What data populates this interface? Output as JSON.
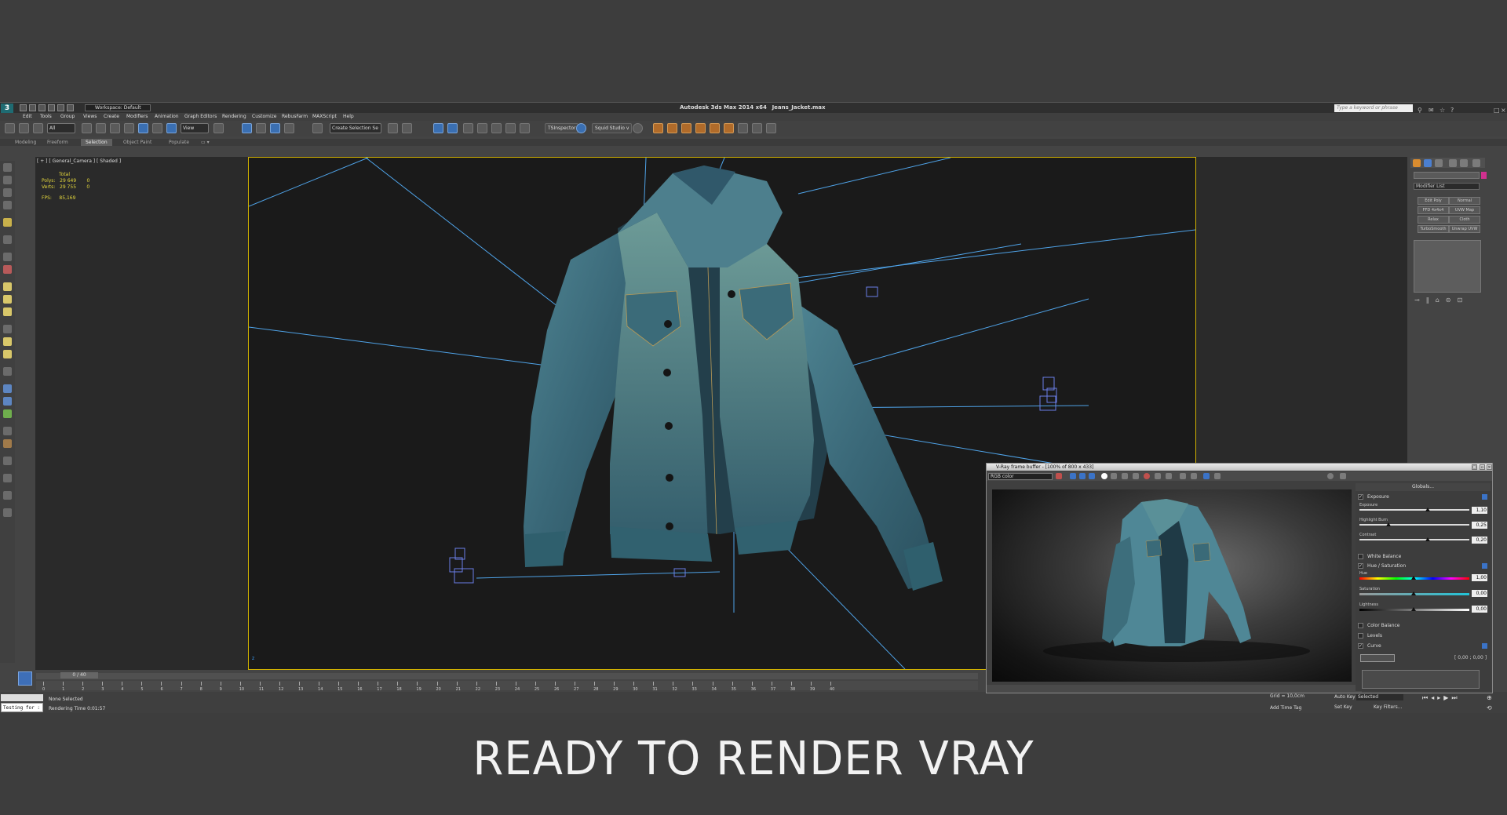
{
  "app": {
    "title_prefix": "Autodesk 3ds Max  2014 x64",
    "filename": "Jeans_Jacket.max",
    "workspace": "Workspace: Default",
    "search_placeholder": "Type a keyword or phrase",
    "menus": [
      "Edit",
      "Tools",
      "Group",
      "Views",
      "Create",
      "Modifiers",
      "Animation",
      "Graph Editors",
      "Rendering",
      "Customize",
      "RebusFarm",
      "MAXScript",
      "Help"
    ]
  },
  "toolbar": {
    "filter": "All",
    "view": "View",
    "selection_set": "Create Selection Se",
    "ts_inspector": "TSInspector",
    "squid": "Squid Studio v"
  },
  "ribbon": {
    "tabs": [
      "Modeling",
      "Freeform",
      "Selection",
      "Object Paint",
      "Populate"
    ],
    "active": "Selection"
  },
  "viewport": {
    "label": "[ + ] [ General_Camera ] [ Shaded ]",
    "stats": {
      "header": "Total",
      "polys": "Polys:   29 649       0",
      "verts": "Verts:   29 755       0",
      "fps": "FPS:     85,169"
    }
  },
  "command_panel": {
    "modifier_list": "Modifier List",
    "buttons": [
      "Edit Poly",
      "Normal",
      "FFD 4x4x4",
      "UVW Map",
      "Relax",
      "Cloth",
      "TurboSmooth",
      "Unwrap UVW"
    ]
  },
  "timeline": {
    "frame": "0 / 40",
    "ticks": [
      "0",
      "1",
      "2",
      "3",
      "4",
      "5",
      "6",
      "7",
      "8",
      "9",
      "10",
      "11",
      "12",
      "13",
      "14",
      "15",
      "16",
      "17",
      "18",
      "19",
      "20",
      "21",
      "22",
      "23",
      "24",
      "25",
      "26",
      "27",
      "28",
      "29",
      "30",
      "31",
      "32",
      "33",
      "34",
      "35",
      "36",
      "37",
      "38",
      "39",
      "40"
    ]
  },
  "status": {
    "selection": "None Selected",
    "render_time": "Rendering Time  0:01:57",
    "script_box": "Testing for :",
    "grid": "Grid = 10,0cm",
    "add_time_tag": "Add Time Tag",
    "auto_key": "Auto Key",
    "selected": "Selected",
    "set_key": "Set Key",
    "key_filters": "Key Filters..."
  },
  "vfb": {
    "title": "V-Ray frame buffer - [100% of 800 x 433]",
    "channel": "RGB color",
    "globals": "Globals...",
    "corrections": {
      "exposure": "Exposure",
      "exposure_label": "Exposure",
      "exposure_value": "1,10",
      "highlight_label": "Highlight Burn",
      "highlight_value": "0,25",
      "contrast_label": "Contrast",
      "contrast_value": "0,20",
      "white_balance": "White Balance",
      "hue_sat": "Hue / Saturation",
      "hue_label": "Hue",
      "hue_value": "1,00",
      "sat_label": "Saturation",
      "sat_value": "0,00",
      "light_label": "Lightness",
      "light_value": "0,00",
      "color_balance": "Color Balance",
      "levels": "Levels",
      "curve": "Curve",
      "curve_readout": "[ 0,00 ; 0,00 ]"
    }
  },
  "banner": "READY TO RENDER  VRAY",
  "colors": {
    "selection_yellow": "#d0b100",
    "light_line": "#4fa3e8",
    "denim": "#3f6f80",
    "vray_blue": "#3b73c7"
  }
}
